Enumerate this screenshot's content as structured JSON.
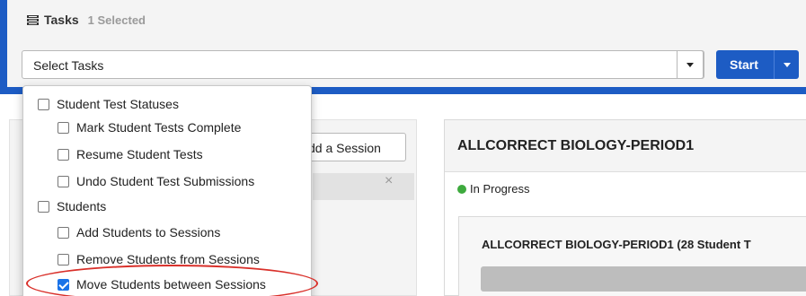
{
  "tasks": {
    "title": "Tasks",
    "selected_count": "1 Selected",
    "select_label": "Select Tasks",
    "start_label": "Start",
    "icon": "list-icon"
  },
  "left_panel": {
    "add_session_label": "dd a Session",
    "close_glyph": "×"
  },
  "session": {
    "title": "ALLCORRECT BIOLOGY-PERIOD1",
    "status": "In Progress",
    "status_color": "#3eaa3e",
    "card_title": "ALLCORRECT BIOLOGY-PERIOD1 (28 Student T"
  },
  "dropdown": {
    "items": [
      {
        "label": "Student Test Statuses",
        "checked": false
      },
      {
        "label": "Mark Student Tests Complete",
        "checked": false
      },
      {
        "label": "Resume Student Tests",
        "checked": false
      },
      {
        "label": "Undo Student Test Submissions",
        "checked": false
      },
      {
        "label": "Students",
        "checked": false
      },
      {
        "label": "Add Students to Sessions",
        "checked": false
      },
      {
        "label": "Remove Students from Sessions",
        "checked": false
      },
      {
        "label": "Move Students between Sessions",
        "checked": true
      }
    ]
  },
  "colors": {
    "brand": "#1d5cc4",
    "highlight": "#d9302a",
    "checkbox_checked": "#1a73e8"
  }
}
